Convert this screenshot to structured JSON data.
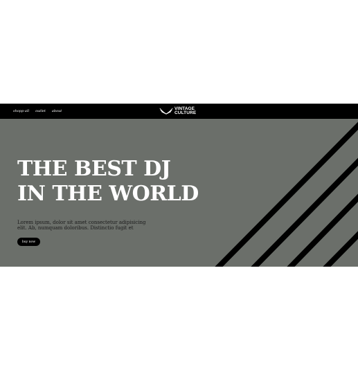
{
  "nav": {
    "items": [
      {
        "label": "shopp-all"
      },
      {
        "label": "outlet"
      },
      {
        "label": "about"
      }
    ]
  },
  "brand": {
    "line1": "VINTAGE",
    "line2": "CULTURE",
    "logo_icon": "wings-icon"
  },
  "hero": {
    "headline_line1": "THE BEST DJ",
    "headline_line2": "IN THE WORLD",
    "description": "Lorem ipsum, dolor sit amet consectetur adipisicing elit. Ab, numquam doloribus. Distinctio fugit et",
    "cta_label": "buy now"
  },
  "colors": {
    "navbar_bg": "#000000",
    "hero_bg": "#6b6f6a",
    "stripes": "#000000",
    "headline": "#ffffff",
    "page_bg": "#ffffff"
  }
}
